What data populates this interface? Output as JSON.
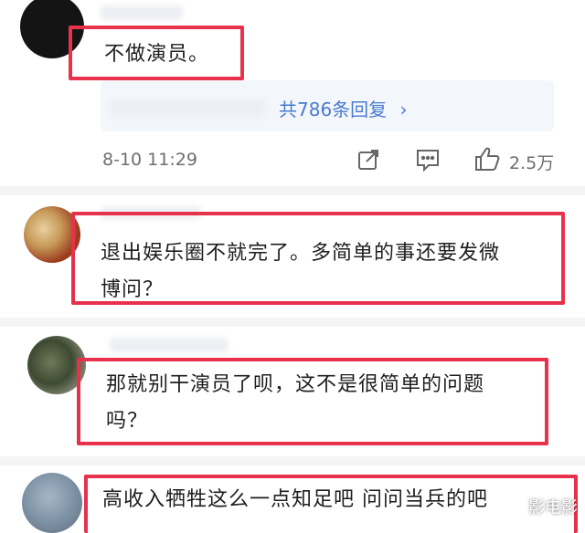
{
  "comments": [
    {
      "text": "不做演员。"
    },
    {
      "text_line1": "退出娱乐圈不就完了。多简单的事还要发微",
      "text_line2": "博问？"
    },
    {
      "text_line1": "那就别干演员了呗，这不是很简单的问题",
      "text_line2": "吗？"
    },
    {
      "text": "高收入牺牲这么一点知足吧 问问当兵的吧"
    }
  ],
  "replies": {
    "label": "共786条回复"
  },
  "meta": {
    "timestamp": "8-10 11:29",
    "like_count": "2.5万",
    "icons": [
      "share-icon",
      "comment-icon",
      "like-icon"
    ]
  },
  "watermark": {
    "text": "影电影"
  },
  "colors": {
    "highlight": "#e8314a",
    "link": "#4a7bd0"
  }
}
